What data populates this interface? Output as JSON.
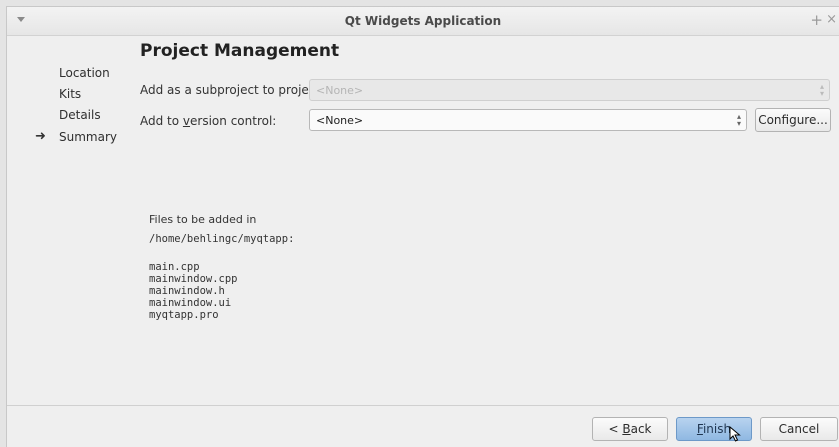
{
  "window": {
    "title": "Qt Widgets Application"
  },
  "sidebar": {
    "items": [
      {
        "label": "Location"
      },
      {
        "label": "Kits"
      },
      {
        "label": "Details"
      },
      {
        "label": "Summary",
        "current": true
      }
    ]
  },
  "page": {
    "heading": "Project Management",
    "subproject": {
      "label": "Add as a subproject to project:",
      "value": "<None>"
    },
    "version_control": {
      "label": "Add to version control:",
      "value": "<None>",
      "configure_label": "Configure..."
    }
  },
  "files": {
    "intro": "Files to be added in",
    "path": "/home/behlingc/myqtapp:",
    "list": [
      "main.cpp",
      "mainwindow.cpp",
      "mainwindow.h",
      "mainwindow.ui",
      "myqtapp.pro"
    ]
  },
  "buttons": {
    "back": "< Back",
    "finish": "Finish",
    "cancel": "Cancel"
  }
}
